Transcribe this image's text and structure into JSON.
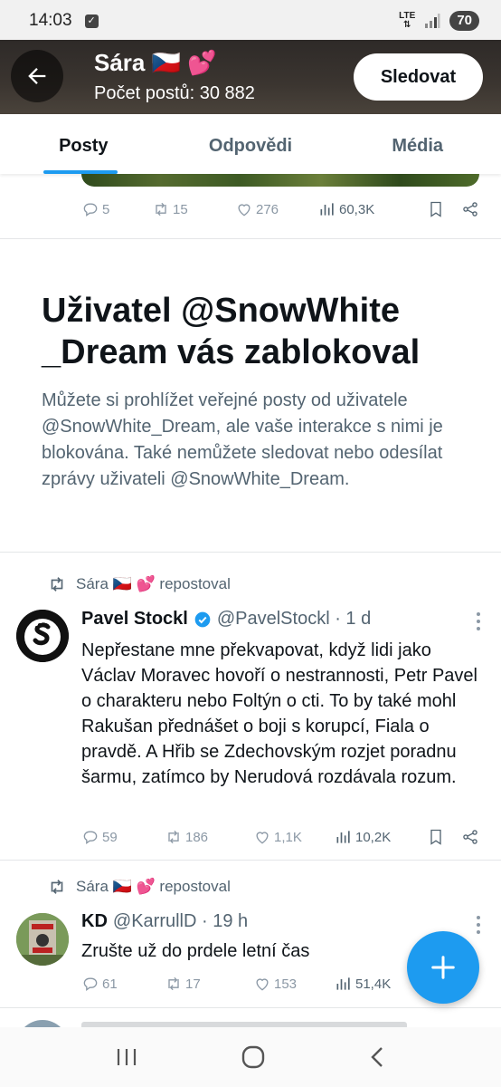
{
  "status_bar": {
    "time": "14:03",
    "network": "LTE",
    "battery": "70"
  },
  "header": {
    "name": "Sára 🇨🇿 💕",
    "post_count": "Počet postů: 30 882",
    "follow_label": "Sledovat"
  },
  "tabs": [
    {
      "label": "Posty"
    },
    {
      "label": "Odpovědi"
    },
    {
      "label": "Média"
    }
  ],
  "top_post": {
    "replies": "5",
    "reposts": "15",
    "likes": "276",
    "views": "60,3K"
  },
  "blocked": {
    "title": "Uživatel @SnowWhite _Dream vás zablokoval",
    "description": "Můžete si prohlížet veřejné posty od uživatele @SnowWhite_Dream, ale vaše interakce s nimi je blokována. Také nemůžete sledovat nebo odesílat zprávy uživateli @SnowWhite_Dream."
  },
  "tweets": [
    {
      "repost_label": "Sára 🇨🇿 💕 repostoval",
      "name": "Pavel Stockl",
      "handle": "@PavelStockl · 1 d",
      "text": "Nepřestane mne překvapovat, když lidi jako Václav Moravec hovoří o nestrannosti, Petr Pavel o charakteru nebo Foltýn o cti. To by také mohl Rakušan přednášet o boji s korupcí, Fiala o pravdě. A Hřib se Zdechovským rozjet poradnu šarmu, zatímco by Nerudová rozdávala rozum.",
      "replies": "59",
      "reposts": "186",
      "likes": "1,1K",
      "views": "10,2K"
    },
    {
      "repost_label": "Sára 🇨🇿 💕 repostoval",
      "name": "KD",
      "handle": "@KarrullD · 19 h",
      "text": "Zrušte už do prdele letní čas",
      "replies": "61",
      "reposts": "17",
      "likes": "153",
      "views": "51,4K"
    }
  ],
  "icons": {
    "back": "arrow-left-icon",
    "reply": "reply-icon",
    "repost": "repost-icon",
    "like": "heart-icon",
    "views": "views-icon",
    "bookmark": "bookmark-icon",
    "share": "share-icon",
    "compose": "plus-icon",
    "verified": "verified-badge-icon"
  },
  "colors": {
    "accent": "#1d9bf0",
    "text": "#0f1419",
    "muted": "#536471"
  }
}
